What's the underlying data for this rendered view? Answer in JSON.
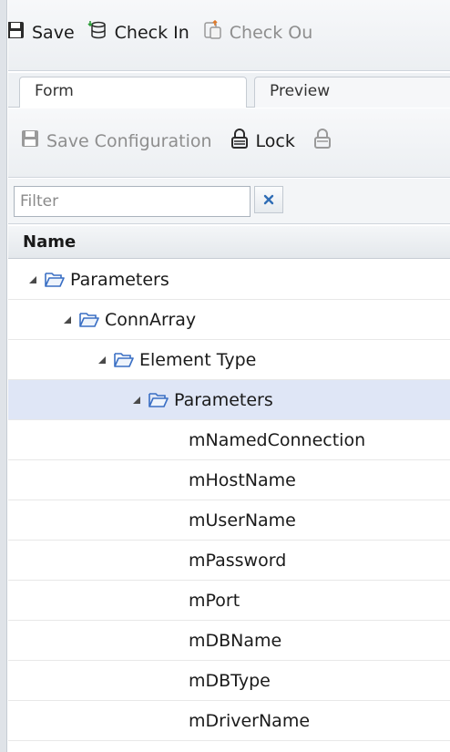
{
  "toolbar": {
    "save_label": "Save",
    "checkin_label": "Check In",
    "checkout_label": "Check Ou"
  },
  "tabs": [
    {
      "label": "Form"
    },
    {
      "label": "Preview"
    }
  ],
  "config_toolbar": {
    "save_config_label": "Save Configuration",
    "lock_label": "Lock"
  },
  "filter": {
    "placeholder": "Filter",
    "value": ""
  },
  "grid": {
    "column_name": "Name"
  },
  "tree": [
    {
      "label": "Parameters",
      "level": 0,
      "type": "folder"
    },
    {
      "label": "ConnArray",
      "level": 1,
      "type": "folder"
    },
    {
      "label": "Element Type",
      "level": 2,
      "type": "folder"
    },
    {
      "label": "Parameters",
      "level": 3,
      "type": "folder",
      "selected": true
    },
    {
      "label": "mNamedConnection",
      "level": 4,
      "type": "leaf"
    },
    {
      "label": "mHostName",
      "level": 4,
      "type": "leaf"
    },
    {
      "label": "mUserName",
      "level": 4,
      "type": "leaf"
    },
    {
      "label": "mPassword",
      "level": 4,
      "type": "leaf"
    },
    {
      "label": "mPort",
      "level": 4,
      "type": "leaf"
    },
    {
      "label": "mDBName",
      "level": 4,
      "type": "leaf"
    },
    {
      "label": "mDBType",
      "level": 4,
      "type": "leaf"
    },
    {
      "label": "mDriverName",
      "level": 4,
      "type": "leaf"
    }
  ],
  "colors": {
    "selected_row": "#dfe6f6",
    "folder_icon": "#3a6fc4",
    "disabled_text": "#8e8e8e"
  }
}
